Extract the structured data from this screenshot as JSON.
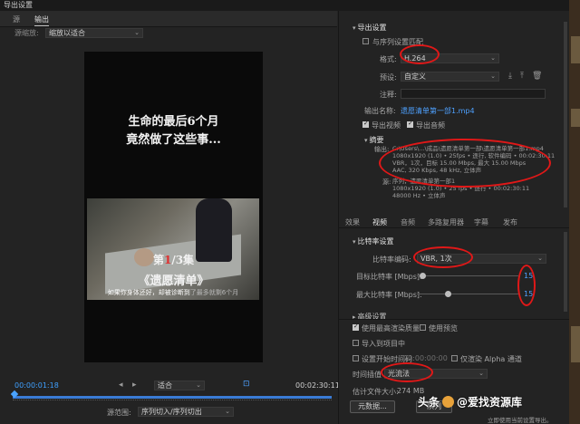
{
  "window": {
    "title": "导出设置"
  },
  "left_tabs": [
    "源",
    "输出"
  ],
  "source_scaling": {
    "label": "源缩放:",
    "value": "缩放以适合"
  },
  "video": {
    "headline_1": "生命的最后6个月",
    "headline_2": "竟然做了这些事...",
    "subtitle_main": "如果你身体还好，却被诊断到",
    "subtitle_dim": "了最多就剩6个月",
    "episode_prefix": "第",
    "episode_num": "1",
    "episode_suffix": "/3集",
    "show_title": "《遗愿清单》"
  },
  "playback": {
    "timecode_in": "00:00:01:18",
    "fit_label": "适合",
    "timecode_out": "00:02:30:11",
    "source_range_label": "源范围:",
    "source_range_value": "序列切入/序列切出"
  },
  "export_settings": {
    "section": "导出设置",
    "match_sequence": "与序列设置匹配",
    "format_label": "格式:",
    "format_value": "H.264",
    "preset_label": "预设:",
    "preset_value": "自定义",
    "comment_label": "注释:",
    "output_name_label": "输出名称:",
    "output_name_value": "遗愿清单第一部1.mp4",
    "export_video": "导出视频",
    "export_audio": "导出音频"
  },
  "summary": {
    "label": "摘要",
    "output_label": "输出:",
    "output_lines": [
      "C:\\Users\\...\\成品\\遗愿清单第一部\\遗愿清单第一部1.mp4",
      "1080x1920 (1.0) • 25fps • 逐行, 软件编码 • 00:02:30:11",
      "VBR，1次，目标 15.00 Mbps, 最大 15.00 Mbps",
      "AAC, 320 Kbps, 48 kHz, 立体声"
    ],
    "source_label": "源:",
    "source_lines": [
      "序列，遗愿清单第一部1",
      "1080x1920 (1.0) • 25 fps • 逐行 • 00:02:30:11",
      "48000 Hz • 立体声"
    ]
  },
  "right_tabs": [
    "效果",
    "视频",
    "音频",
    "多路复用器",
    "字幕",
    "发布"
  ],
  "bitrate": {
    "section": "比特率设置",
    "encoding_label": "比特率编码:",
    "encoding_value": "VBR, 1次",
    "target_label": "目标比特率 [Mbps]:",
    "target_value": "15",
    "max_label": "最大比特率 [Mbps]:",
    "max_value": "15",
    "target_level": 0.05,
    "max_level": 0.3
  },
  "advanced": {
    "section": "高级设置"
  },
  "options": {
    "max_render_quality": "使用最高渲染质量",
    "use_previews": "使用预览",
    "import_into_project": "导入到项目中",
    "set_start_timecode": "设置开始时间码",
    "start_timecode_value": "00:00:00:00",
    "render_alpha_only": "仅渲染 Alpha 通道",
    "time_interpolation_label": "时间插值",
    "time_interpolation_value": "光流法",
    "file_size_label": "估计文件大小:",
    "file_size_value": "274 MB"
  },
  "buttons": {
    "metadata": "元数据...",
    "queue": "队列"
  },
  "watermark": {
    "head": "头条",
    "at": "@爱找资源库"
  },
  "status": {
    "text": "立即使用当前设置导出。"
  }
}
